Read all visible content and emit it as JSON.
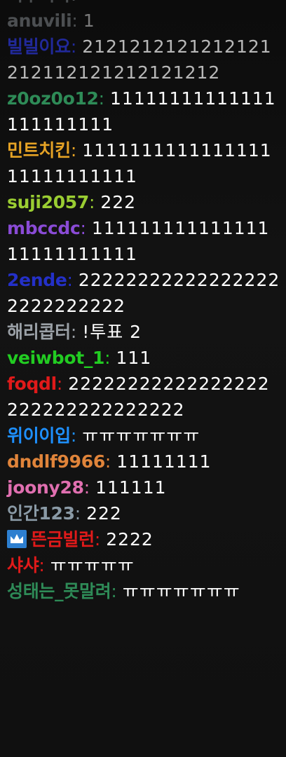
{
  "messages": [
    {
      "user": "비투비야",
      "color": "#9aa0a6",
      "text": "ㅋㅋㅋㅋㅋ",
      "faded": true
    },
    {
      "user": "anuvili",
      "color": "#9aa0a6",
      "text": "1",
      "faded": true
    },
    {
      "user": "빌빌이요",
      "color": "#2a35d6",
      "text": "2121212121212121212112121212121212",
      "dim": true
    },
    {
      "user": "z0oz0o12",
      "color": "#2e8b57",
      "text": "11111111111111111111111"
    },
    {
      "user": "민트치킨",
      "color": "#e6a325",
      "text": "111111111111111111111111111"
    },
    {
      "user": "suji2057",
      "color": "#9acd32",
      "text": "222"
    },
    {
      "user": "mbccdc",
      "color": "#8a4bd6",
      "text": "11111111111111111111111111"
    },
    {
      "user": "2ende",
      "color": "#2430c8",
      "text": "222222222222222222222222222"
    },
    {
      "user": "해리콥터",
      "color": "#9aa0a6",
      "text": "!투표 2"
    },
    {
      "user": "veiwbot_1",
      "color": "#22cc22",
      "text": "111"
    },
    {
      "user": "foqdl",
      "color": "#e01a1a",
      "text": "22222222222222222222222222222222"
    },
    {
      "user": "위이이입",
      "color": "#1e90ff",
      "text": "ㅠㅠㅠㅠㅠㅠㅠ"
    },
    {
      "user": "dndlf9966",
      "color": "#e0843a",
      "text": "11111111"
    },
    {
      "user": "joony28",
      "color": "#e06fb0",
      "text": "111111"
    },
    {
      "user": "인간123",
      "color": "#8a9aa6",
      "text": "222"
    },
    {
      "user": "뜬금빌런",
      "color": "#e01a1a",
      "text": "2222",
      "badge": "crown-icon"
    },
    {
      "user": "샤샤",
      "color": "#e01a1a",
      "text": "ㅠㅠㅠㅠㅠ"
    },
    {
      "user": "성태는_못말려",
      "color": "#2e8b57",
      "text": "ㅠㅠㅠㅠㅠㅠㅠ"
    }
  ],
  "separator": ": "
}
